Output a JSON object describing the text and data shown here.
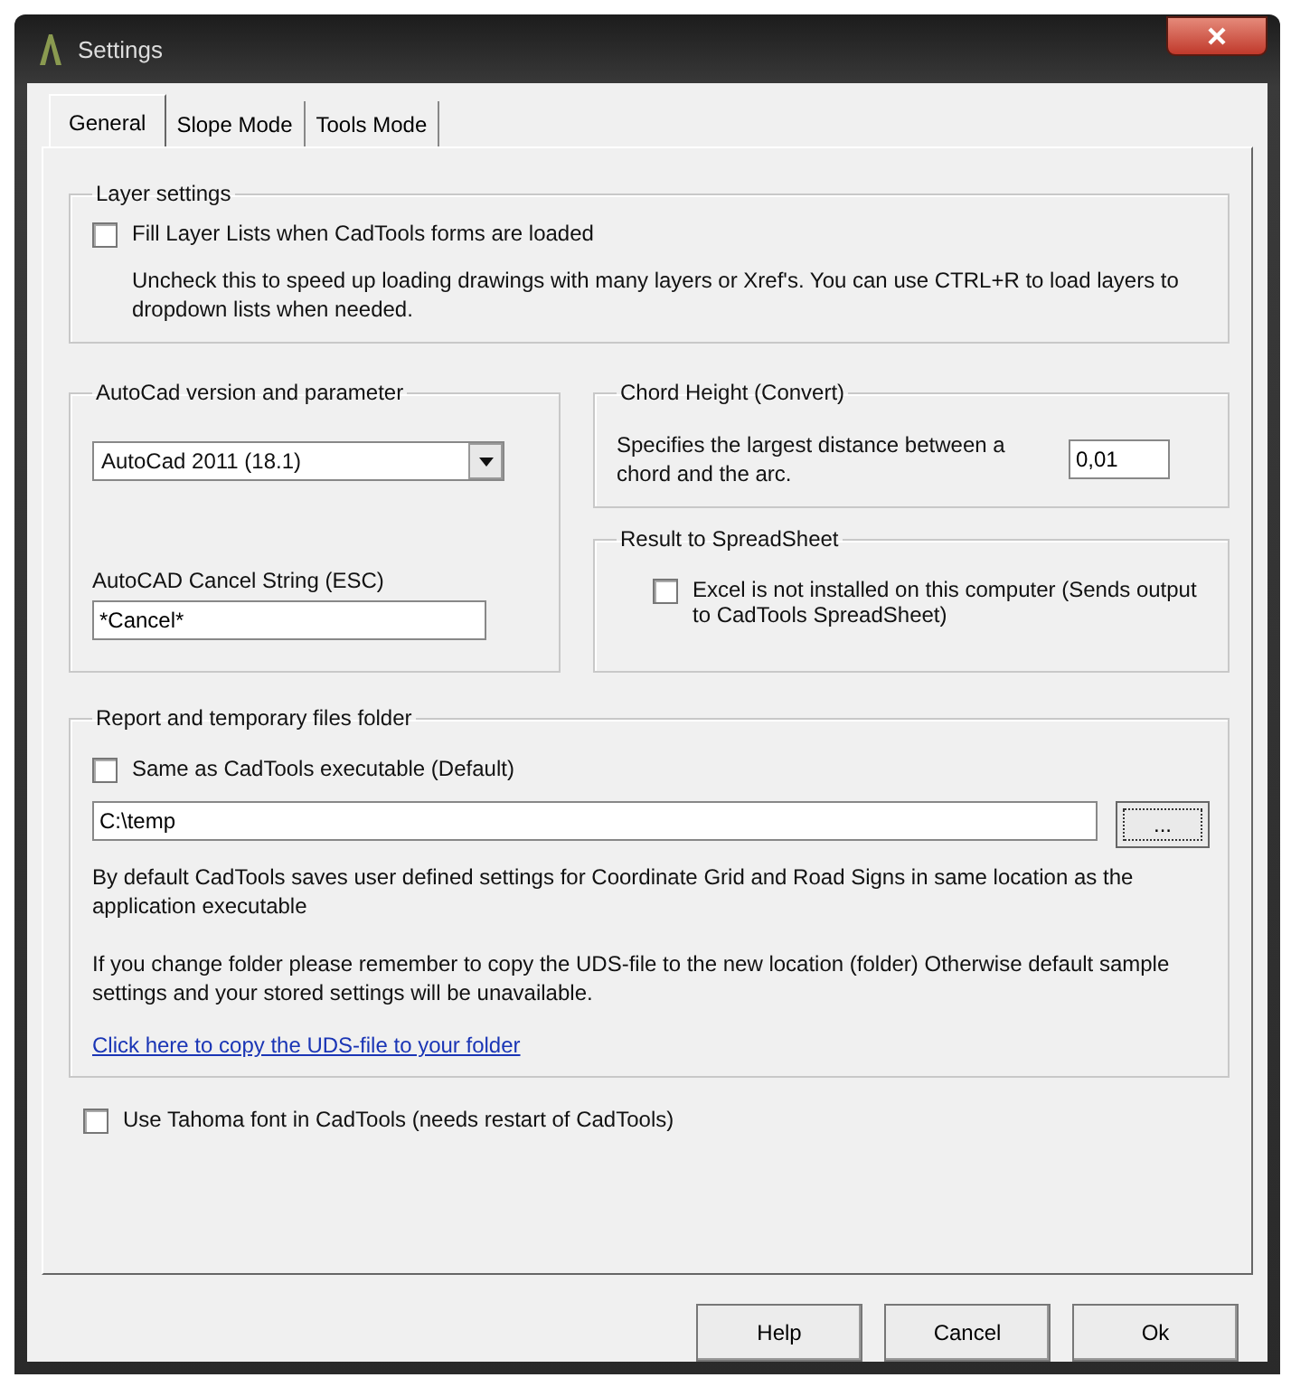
{
  "window": {
    "title": "Settings"
  },
  "tabs": [
    {
      "label": "General",
      "selected": true
    },
    {
      "label": "Slope Mode",
      "selected": false
    },
    {
      "label": "Tools Mode",
      "selected": false
    }
  ],
  "layer_settings": {
    "title": "Layer settings",
    "checkbox": {
      "label": "Fill Layer Lists when CadTools forms are loaded",
      "checked": false
    },
    "note": "Uncheck this to speed up loading drawings with many layers or Xref's. You can use CTRL+R to load layers to dropdown lists when needed."
  },
  "autocad": {
    "title": "AutoCad version and parameter",
    "version": "AutoCad 2011 (18.1)",
    "cancel_label": "AutoCAD Cancel String (ESC)",
    "cancel_value": "*Cancel*"
  },
  "chord_height": {
    "title": "Chord Height (Convert)",
    "label": "Specifies the largest distance between a chord and the arc.",
    "value": "0,01"
  },
  "spreadsheet": {
    "title": "Result to SpreadSheet",
    "checkbox": {
      "label": "Excel is not installed on this computer (Sends output to CadTools SpreadSheet)",
      "checked": false
    }
  },
  "report_folder": {
    "title": "Report and temporary files folder",
    "checkbox": {
      "label": "Same as CadTools executable (Default)",
      "checked": false
    },
    "path": "C:\\temp",
    "browse": "...",
    "note_1": "By default CadTools saves user defined settings for Coordinate Grid and Road Signs in same location as the application executable",
    "note_2": "If you change folder please remember to copy the UDS-file to the new location (folder) Otherwise default sample settings and your stored settings will be unavailable.",
    "link": "Click here to copy the UDS-file to your folder"
  },
  "tahoma": {
    "label": "Use Tahoma font in CadTools (needs restart of CadTools)",
    "checked": false
  },
  "buttons": [
    "Help",
    "Cancel",
    "Ok"
  ]
}
